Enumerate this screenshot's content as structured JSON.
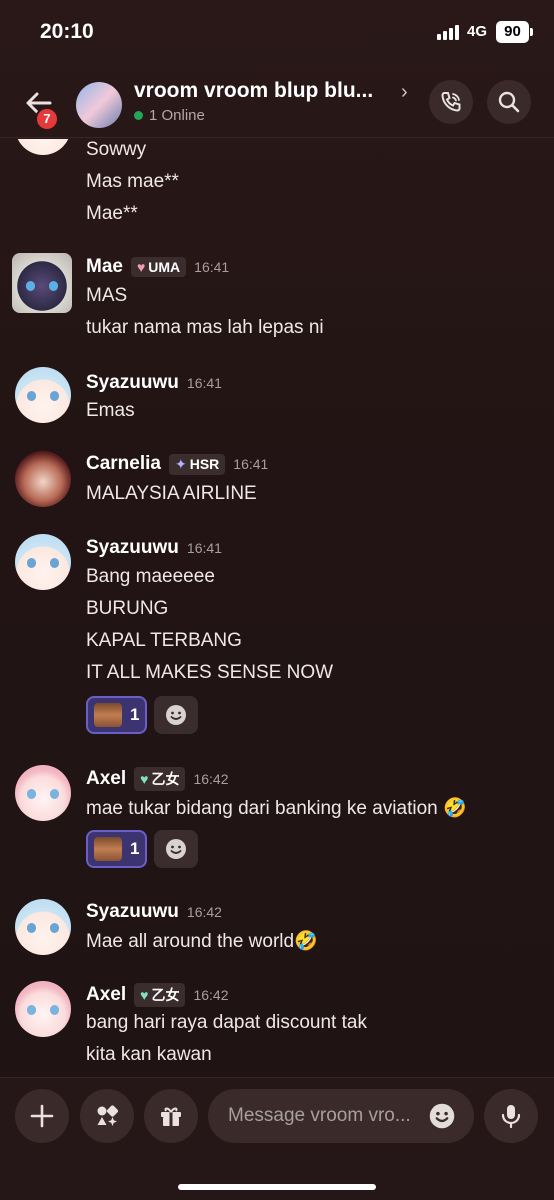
{
  "status": {
    "time": "20:10",
    "network": "4G",
    "battery": "90"
  },
  "header": {
    "title": "vroom vroom blup blu...",
    "online": "1 Online",
    "unread_badge": "7",
    "icons": [
      "back-arrow-icon",
      "call-icon",
      "search-icon"
    ]
  },
  "messages": {
    "partial": [
      "Sowwy",
      "Mas mae**",
      "Mae**"
    ],
    "m1": {
      "author": "Mae",
      "tag": "UMA",
      "time": "16:41",
      "lines": [
        "MAS",
        "tukar nama mas lah lepas ni"
      ]
    },
    "m2": {
      "author": "Syazuuwu",
      "time": "16:41",
      "lines": [
        "Emas"
      ]
    },
    "m3": {
      "author": "Carnelia",
      "tag": "HSR",
      "time": "16:41",
      "lines": [
        "MALAYSIA AIRLINE"
      ]
    },
    "m4": {
      "author": "Syazuuwu",
      "time": "16:41",
      "lines": [
        "Bang maeeeee",
        "BURUNG",
        "KAPAL TERBANG",
        "IT ALL MAKES SENSE NOW"
      ],
      "reaction_count": "1"
    },
    "m5": {
      "author": "Axel",
      "tag": "乙女",
      "time": "16:42",
      "lines": [
        "mae tukar bidang dari banking ke aviation 🤣"
      ],
      "reaction_count": "1"
    },
    "m6": {
      "author": "Syazuuwu",
      "time": "16:42",
      "lines": [
        "Mae all around the world🤣"
      ]
    },
    "m7": {
      "author": "Axel",
      "tag": "乙女",
      "time": "16:42",
      "lines": [
        "bang hari raya dapat discount tak",
        "kita kan kawan"
      ]
    }
  },
  "composer": {
    "placeholder": "Message vroom vro..."
  },
  "colors": {
    "background": "#2a1818",
    "online_dot": "#23a55a",
    "badge": "#e5393a",
    "reaction_border": "#6a5fc8"
  }
}
